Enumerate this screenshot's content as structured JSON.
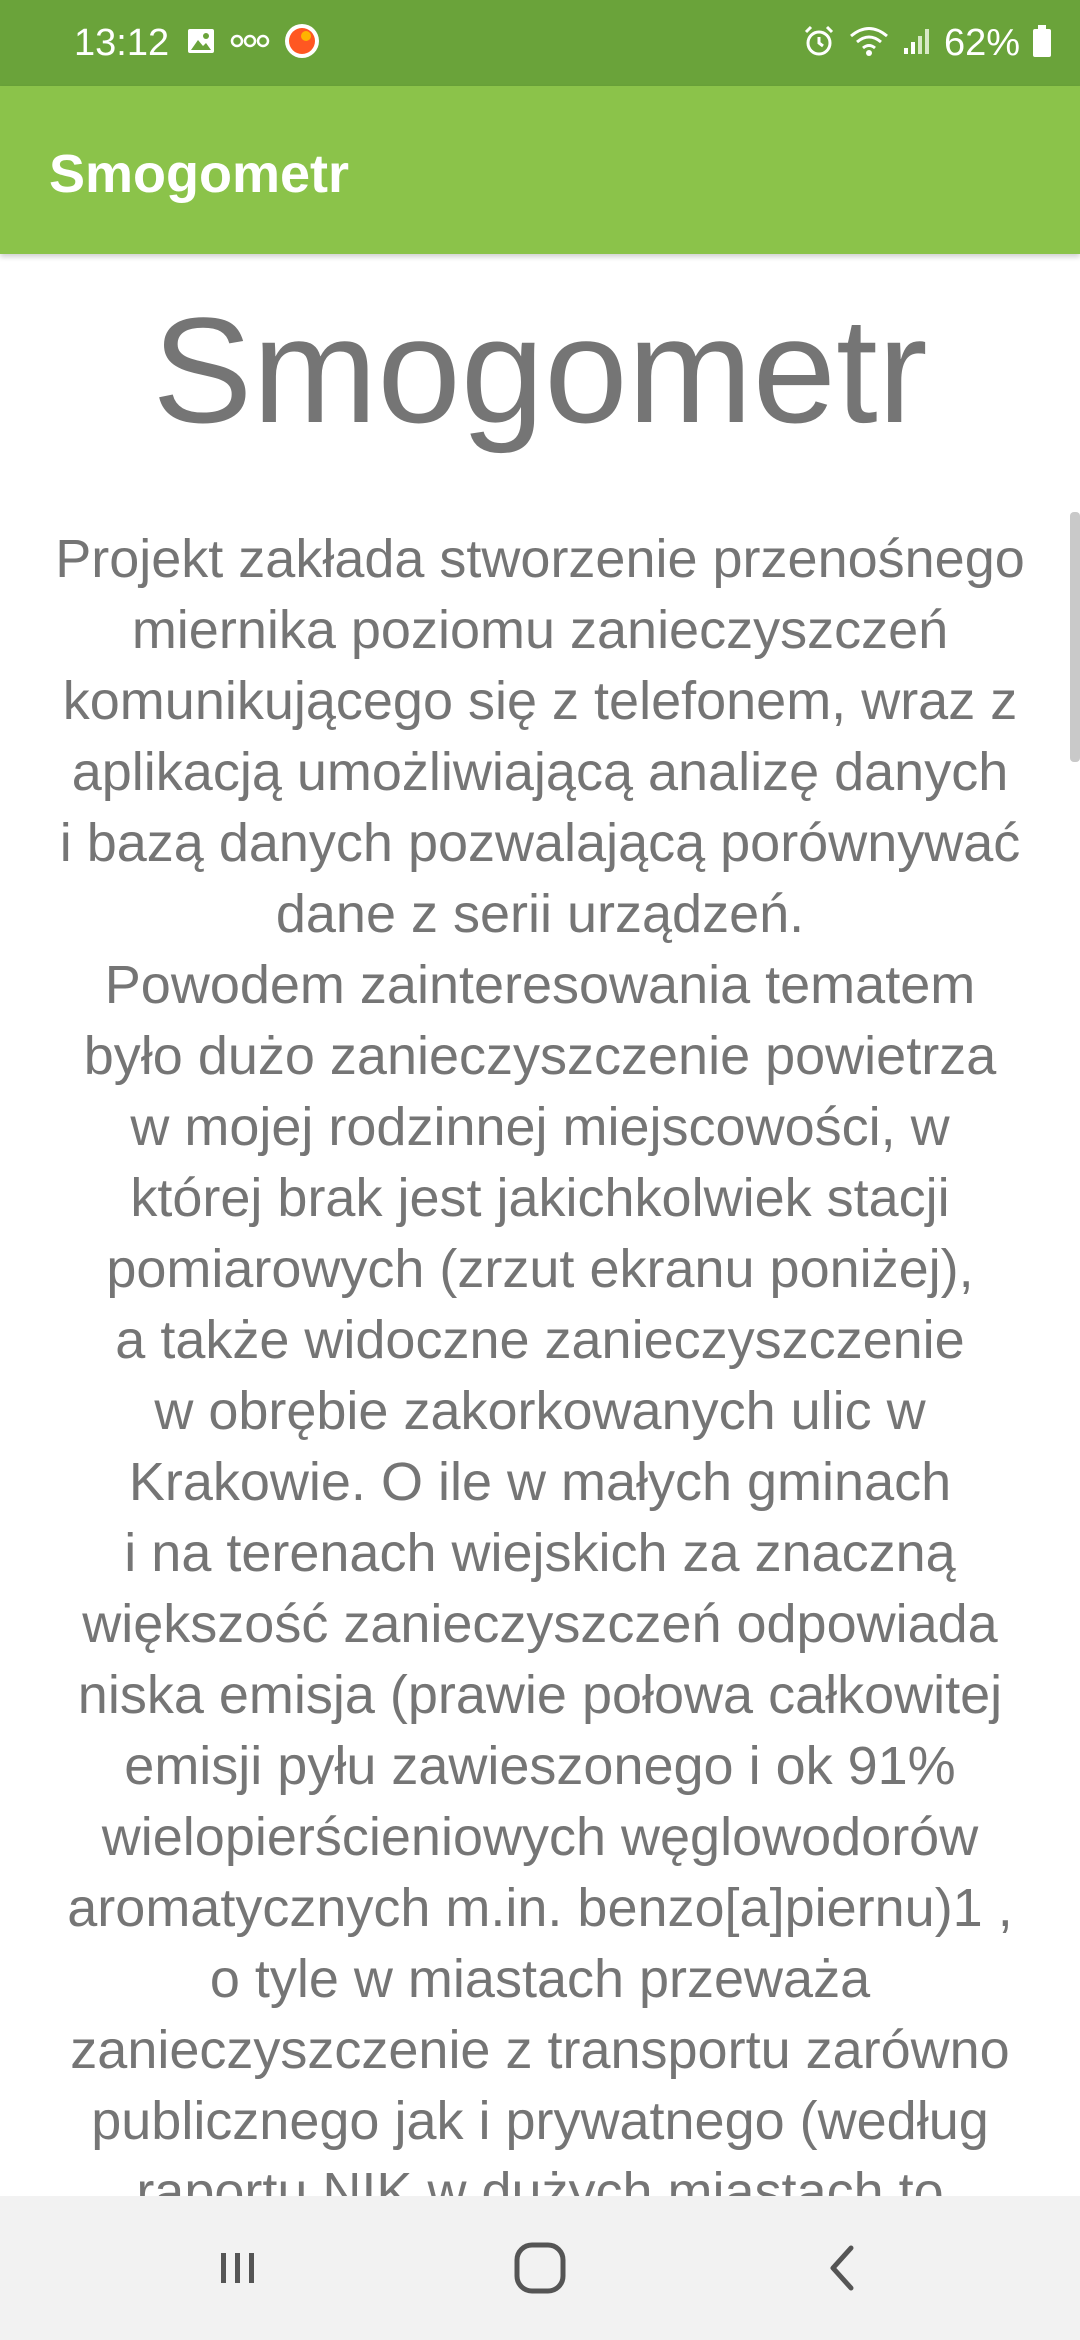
{
  "status_bar": {
    "time": "13:12",
    "battery": "62%",
    "icons_left": [
      "image-icon",
      "voicemail-icon",
      "app-notification-icon"
    ],
    "icons_right": [
      "alarm-icon",
      "wifi-icon",
      "signal-icon",
      "battery-icon"
    ],
    "bar_color": "#6aa33a"
  },
  "app_bar": {
    "title": "Smogometr",
    "color": "#8bc34a"
  },
  "content": {
    "headline": "Smogometr",
    "lines": [
      "Projekt zakłada stworzenie przenośnego",
      "miernika poziomu zanieczyszczeń",
      "komunikującego się z telefonem, wraz z",
      "aplikacją umożliwiającą analizę danych",
      "i bazą danych pozwalającą porównywać",
      "dane z serii urządzeń.",
      "Powodem zainteresowania tematem",
      "było dużo zanieczyszczenie powietrza",
      "w mojej rodzinnej miejscowości, w",
      "której brak jest jakichkolwiek stacji",
      "pomiarowych (zrzut ekranu poniżej),",
      "a także widoczne zanieczyszczenie",
      "w obrębie zakorkowanych ulic w",
      "Krakowie. O ile w małych gminach",
      "i na terenach wiejskich za znaczną",
      "większość zanieczyszczeń odpowiada",
      "niska emisja (prawie połowa całkowitej",
      "emisji pyłu zawieszonego i ok 91%",
      "wielopierścieniowych węglowodorów",
      "aromatycznych m.in. benzo[a]piernu)1 ,",
      "o tyle w miastach przeważa",
      "zanieczyszczenie z transportu zarówno",
      "publicznego jak i prywatnego (według",
      "raportu NIK w dużych miastach to"
    ],
    "text_color": "#757575"
  },
  "nav_bar": {
    "buttons": [
      "recent-apps",
      "home",
      "back"
    ]
  }
}
